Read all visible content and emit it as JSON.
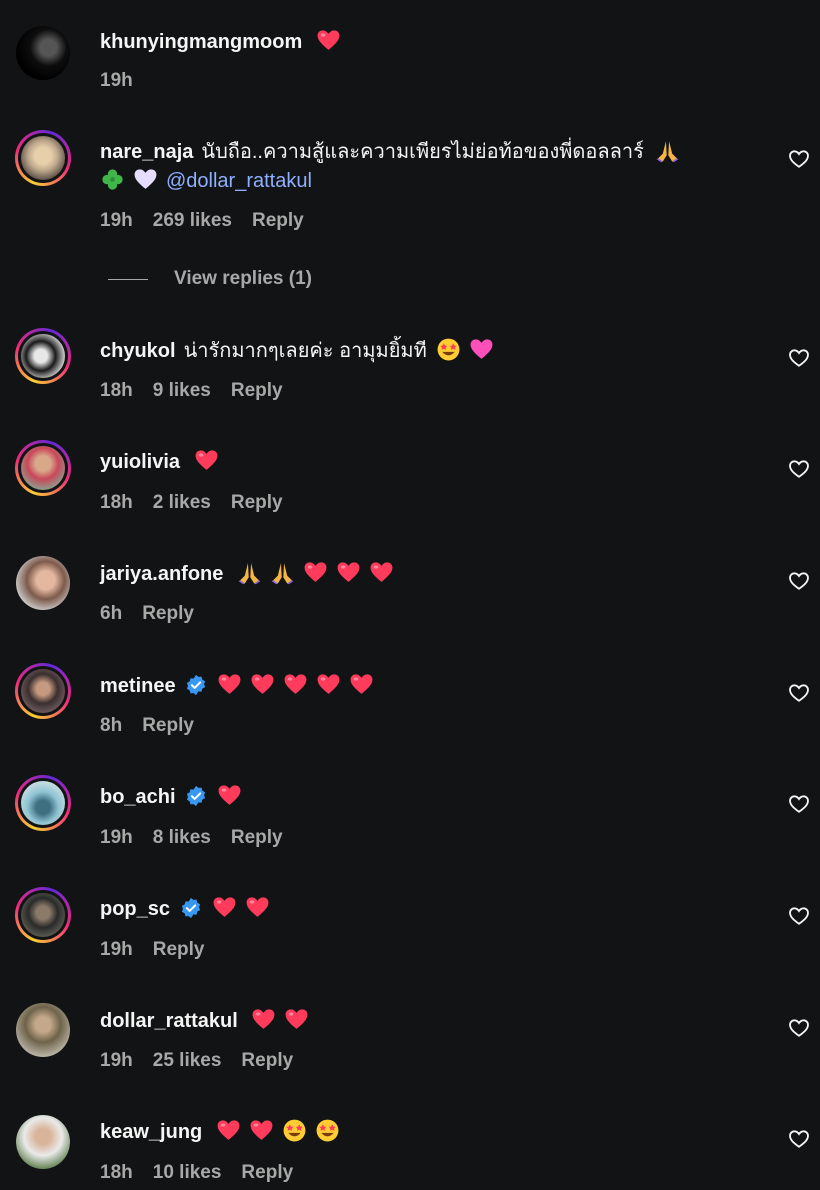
{
  "comments": [
    {
      "username": "khunyingmangmoom",
      "text": "",
      "emojis": [
        "heart-red"
      ],
      "time": "19h",
      "likes": "",
      "reply": "",
      "has_heart_button": false
    },
    {
      "username": "nare_naja",
      "text": "นับถือ..ความสู้และความเพียรไม่ย่อท้อของพี่ดอลลาร์",
      "line2_mention": "@dollar_rattakul",
      "time": "19h",
      "likes": "269 likes",
      "reply": "Reply",
      "has_heart_button": true
    },
    {
      "username": "chyukol",
      "text": "น่ารักมากๆเลยค่ะ อามุมยิ้มที",
      "time": "18h",
      "likes": "9 likes",
      "reply": "Reply",
      "has_heart_button": true
    },
    {
      "username": "yuiolivia",
      "text": "",
      "time": "18h",
      "likes": "2 likes",
      "reply": "Reply",
      "has_heart_button": true
    },
    {
      "username": "jariya.anfone",
      "text": "",
      "time": "6h",
      "likes": "",
      "reply": "Reply",
      "has_heart_button": true
    },
    {
      "username": "metinee",
      "text": "",
      "time": "8h",
      "likes": "",
      "reply": "Reply",
      "has_heart_button": true,
      "verified": true
    },
    {
      "username": "bo_achi",
      "text": "",
      "time": "19h",
      "likes": "8 likes",
      "reply": "Reply",
      "has_heart_button": true,
      "verified": true
    },
    {
      "username": "pop_sc",
      "text": "",
      "time": "19h",
      "likes": "",
      "reply": "Reply",
      "has_heart_button": true,
      "verified": true
    },
    {
      "username": "dollar_rattakul",
      "text": "",
      "time": "19h",
      "likes": "25 likes",
      "reply": "Reply",
      "has_heart_button": true
    },
    {
      "username": "keaw_jung",
      "text": "",
      "time": "18h",
      "likes": "10 likes",
      "reply": "Reply",
      "has_heart_button": true
    }
  ],
  "view_replies": "View replies (1)",
  "colors": {
    "background": "#121314",
    "secondary_text": "#a8a8a8",
    "mention": "#8fb0ff",
    "verified": "#3897f0",
    "heart": "#ff3040"
  }
}
